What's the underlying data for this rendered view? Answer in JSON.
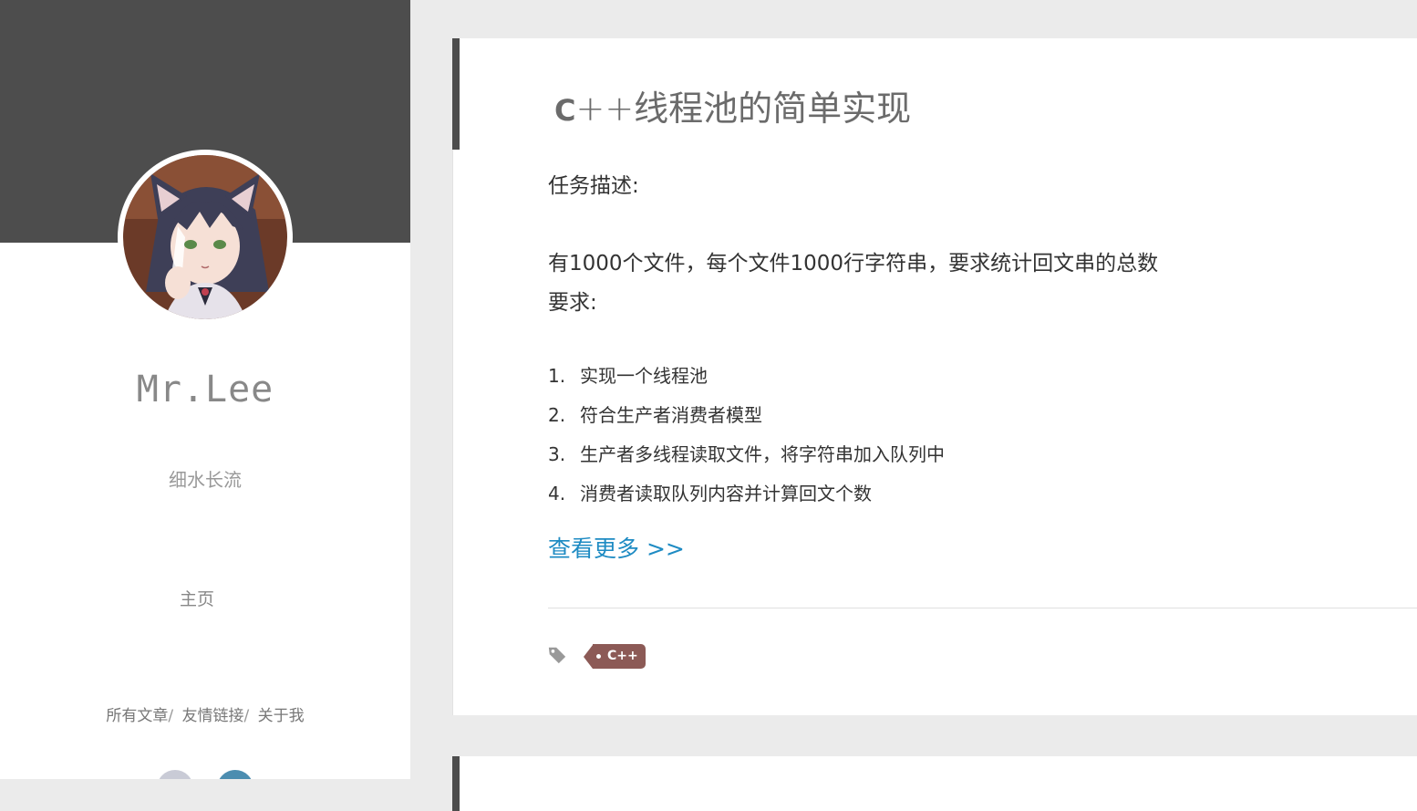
{
  "sidebar": {
    "blog_name": "Mr.Lee",
    "subtitle": "细水长流",
    "home_label": "主页",
    "links": [
      {
        "label": "所有文章"
      },
      {
        "label": "友情链接"
      },
      {
        "label": "关于我"
      }
    ],
    "separator": "/",
    "avatar_icon": "avatar-anime-cat-girl",
    "header_color": "#4d4d4d"
  },
  "post": {
    "title_prefix": "C",
    "title_rest": "++线程池的简单实现",
    "task_heading": "任务描述:",
    "task_body": "有1000个文件，每个文件1000行字符串，要求统计回文串的总数",
    "requirements_heading": "要求:",
    "requirements": [
      {
        "num": "1.",
        "text": "实现一个线程池"
      },
      {
        "num": "2.",
        "text": "符合生产者消费者模型"
      },
      {
        "num": "3.",
        "text": "生产者多线程读取文件，将字符串加入队列中"
      },
      {
        "num": "4.",
        "text": "消费者读取队列内容并计算回文个数"
      }
    ],
    "read_more": "查看更多 >>",
    "tag_icon": "tag-icon",
    "tags": [
      {
        "label": "C++",
        "color": "#8c5a56"
      }
    ],
    "link_color": "#1e8bc3"
  }
}
